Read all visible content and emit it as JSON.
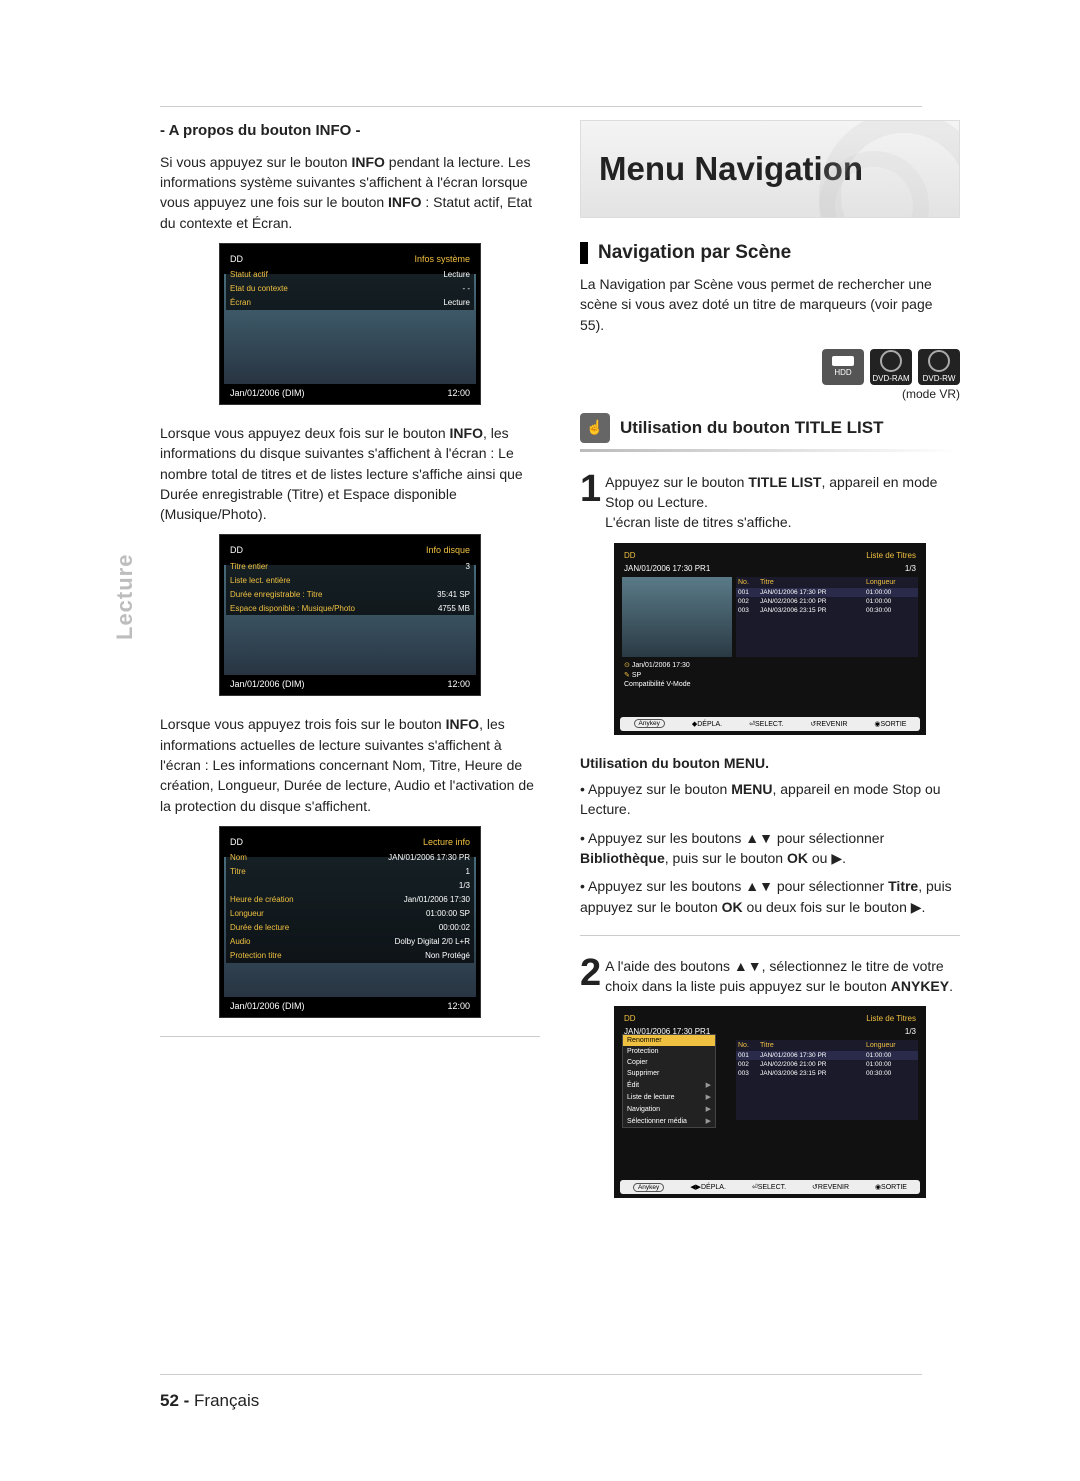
{
  "page": {
    "number": "52 -",
    "lang": "Français",
    "side_tab": "Lecture"
  },
  "left": {
    "heading": "- A propos du bouton INFO -",
    "p1a": "Si vous appuyez sur le bouton ",
    "p1b": "INFO",
    "p1c": " pendant la lecture. Les informations système suivantes s'affichent à l'écran lorsque vous appuyez une fois sur le bouton ",
    "p1d": "INFO",
    "p1e": " : Statut actif, Etat du contexte et Écran.",
    "thumb1": {
      "dd": "DD",
      "title": "Infos système",
      "r1l": "Statut actif",
      "r1v": "Lecture",
      "r2l": "Etat du contexte",
      "r2v": "- -",
      "r3l": "Écran",
      "r3v": "Lecture",
      "bl": "Jan/01/2006 (DIM)",
      "br": "12:00"
    },
    "p2a": "Lorsque vous appuyez deux fois sur le bouton ",
    "p2b": "INFO",
    "p2c": ", les informations du disque suivantes s'affichent à l'écran : Le nombre total de titres et de listes lecture s'affiche ainsi que Durée enregistrable (Titre) et Espace disponible (Musique/Photo).",
    "thumb2": {
      "dd": "DD",
      "title": "Info disque",
      "r1l": "Titre entier",
      "r1v": "3",
      "r2l": "Liste lect. entière",
      "r2v": "",
      "r3l": "Durée enregistrable : Titre",
      "r3v": "35:41  SP",
      "r4l": "Espace disponible : Musique/Photo",
      "r4v": "4755 MB",
      "bl": "Jan/01/2006 (DIM)",
      "br": "12:00"
    },
    "p3a": "Lorsque vous appuyez trois fois sur le bouton ",
    "p3b": "INFO",
    "p3c": ", les informations actuelles de lecture suivantes s'affichent à l'écran : Les informations concernant Nom, Titre, Heure de création, Longueur, Durée de lecture, Audio et l'activation de la protection du disque s'affichent.",
    "thumb3": {
      "dd": "DD",
      "title": "Lecture info",
      "rows": [
        {
          "l": "Nom",
          "v": "JAN/01/2006 17:30 PR"
        },
        {
          "l": "Titre",
          "v": "1"
        },
        {
          "l": "",
          "v": "1/3"
        },
        {
          "l": "Heure de création",
          "v": "Jan/01/2006 17:30"
        },
        {
          "l": "Longueur",
          "v": "01:00:00 SP"
        },
        {
          "l": "Durée de lecture",
          "v": "00:00:02"
        },
        {
          "l": "Audio",
          "v": "Dolby Digital 2/0 L+R"
        },
        {
          "l": "Protection titre",
          "v": "Non Protégé"
        }
      ],
      "bl": "Jan/01/2006 (DIM)",
      "br": "12:00"
    }
  },
  "right": {
    "big_title": "Menu Navigation",
    "nav_heading": "Navigation par Scène",
    "nav_desc": "La Navigation par Scène vous permet de rechercher une scène si vous avez doté un titre de marqueurs (voir page 55).",
    "media": {
      "hdd": "HDD",
      "ram": "DVD-RAM",
      "rw": "DVD-RW"
    },
    "mode_vr": "(mode VR)",
    "sub1": "Utilisation du bouton TITLE LIST",
    "step1_a": "Appuyez sur le bouton ",
    "step1_b": "TITLE LIST",
    "step1_c": ", appareil en mode Stop ou Lecture.",
    "step1_d": "L'écran liste de titres s'affiche.",
    "tv1": {
      "dd": "DD",
      "title": "Liste de Titres",
      "date": "JAN/01/2006 17:30 PR1",
      "page": "1/3",
      "hdr_no": "No.",
      "hdr_title": "Titre",
      "hdr_len": "Longueur",
      "rows": [
        {
          "no": "001",
          "t": "JAN/01/2006 17:30  PR",
          "len": "01:00:00"
        },
        {
          "no": "002",
          "t": "JAN/02/2006 21:00  PR",
          "len": "01:00:00"
        },
        {
          "no": "003",
          "t": "JAN/03/2006 23:15  PR",
          "len": "00:30:00"
        }
      ],
      "meta1": "Jan/01/2006 17:30",
      "meta2": "SP",
      "meta3": "Compatibilité V-Mode",
      "footer": {
        "anykey": "Anykey",
        "f1": "DÉPLA.",
        "f2": "SELECT.",
        "f3": "REVENIR",
        "f4": "SORTIE"
      }
    },
    "mini_head": "Utilisation du bouton MENU.",
    "b1a": "• Appuyez sur le bouton ",
    "b1b": "MENU",
    "b1c": ", appareil en mode Stop ou Lecture.",
    "b2a": "• Appuyez sur les boutons ▲▼ pour sélectionner ",
    "b2b": "Bibliothèque",
    "b2c": ", puis sur le bouton ",
    "b2d": "OK",
    "b2e": " ou ▶.",
    "b3a": "• Appuyez sur les boutons ▲▼ pour sélectionner ",
    "b3b": "Titre",
    "b3c": ", puis appuyez sur le bouton ",
    "b3d": "OK",
    "b3e": " ou deux fois sur le bouton ▶.",
    "step2_a": "A l'aide des boutons ▲▼, sélectionnez le titre de votre choix dans la liste puis appuyez sur le bouton ",
    "step2_b": "ANYKEY",
    "step2_c": ".",
    "tv2_menu": [
      "Renommer",
      "Protection",
      "Copier",
      "Supprimer",
      "Édit",
      "Liste de lecture",
      "Navigation",
      "Sélectionner média"
    ]
  }
}
